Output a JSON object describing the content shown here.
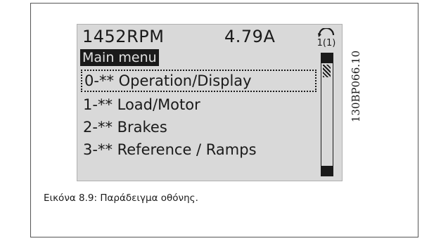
{
  "display": {
    "speed": "1452RPM",
    "current": "4.79A",
    "setup_indicator": "1(1)",
    "menu_title": "Main menu",
    "menu_items": [
      {
        "label": "0-** Operation/Display",
        "selected": true
      },
      {
        "label": "1-** Load/Motor",
        "selected": false
      },
      {
        "label": "2-** Brakes",
        "selected": false
      },
      {
        "label": "3-** Reference / Ramps",
        "selected": false
      }
    ],
    "scroll_position": 0.0
  },
  "figure_code": "130BP066.10",
  "caption": "Εικόνα 8.9: Παράδειγμα οθόνης.",
  "colors": {
    "lcd_background": "#d9d9d9",
    "lcd_foreground": "#1a1a1a",
    "frame_border": "#555555"
  },
  "icons": {
    "setup": "setup-number-icon",
    "scroll_up": "scroll-up-arrow-icon",
    "scroll_down": "scroll-down-arrow-icon"
  }
}
